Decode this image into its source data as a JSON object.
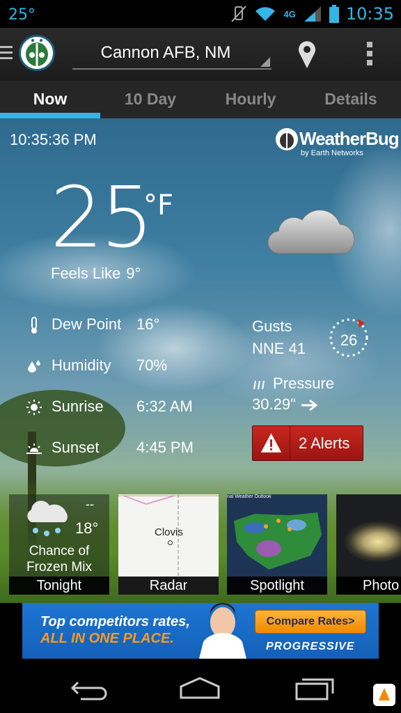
{
  "status_bar": {
    "temperature": "25°",
    "network": "4G",
    "time": "10:35"
  },
  "action_bar": {
    "location": "Cannon AFB, NM"
  },
  "tabs": [
    {
      "label": "Now",
      "active": true
    },
    {
      "label": "10 Day",
      "active": false
    },
    {
      "label": "Hourly",
      "active": false
    },
    {
      "label": "Details",
      "active": false
    }
  ],
  "current": {
    "timestamp": "10:35:36 PM",
    "brand_name": "WeatherBug",
    "brand_sub": "by Earth Networks",
    "temperature": "25",
    "unit": "°F",
    "feels_like_label": "Feels Like",
    "feels_like_value": "9°",
    "condition_icon": "cloudy-icon"
  },
  "stats": [
    {
      "icon": "thermometer-icon",
      "label": "Dew Point",
      "value": "16°"
    },
    {
      "icon": "droplets-icon",
      "label": "Humidity",
      "value": "70%"
    },
    {
      "icon": "sunrise-icon",
      "label": "Sunrise",
      "value": "6:32 AM"
    },
    {
      "icon": "sunset-icon",
      "label": "Sunset",
      "value": "4:45 PM"
    }
  ],
  "wind": {
    "label": "Gusts",
    "value": "NNE 41",
    "compass_speed": "26"
  },
  "pressure": {
    "label": "Pressure",
    "value": "30.29\"",
    "trend_icon": "arrow-right-icon"
  },
  "alerts": {
    "label": "2 Alerts"
  },
  "cards": {
    "tonight": {
      "hi": "--",
      "temp": "18°",
      "condition": "Chance of Frozen Mix",
      "label": "Tonight"
    },
    "radar": {
      "city": "Clovis",
      "label": "Radar"
    },
    "spotlight": {
      "title": "nal Weather Outlook",
      "label": "Spotlight"
    },
    "photo": {
      "label": "Photo"
    }
  },
  "ad": {
    "line1": "Top competitors rates,",
    "line2": "ALL IN ONE PLACE.",
    "cta": "Compare Rates>",
    "brand": "PROGRESSIVE"
  },
  "colors": {
    "accent": "#33b5e5",
    "alert_red": "#c7271f",
    "ad_blue": "#1c76d2",
    "ad_orange": "#f08a00"
  }
}
